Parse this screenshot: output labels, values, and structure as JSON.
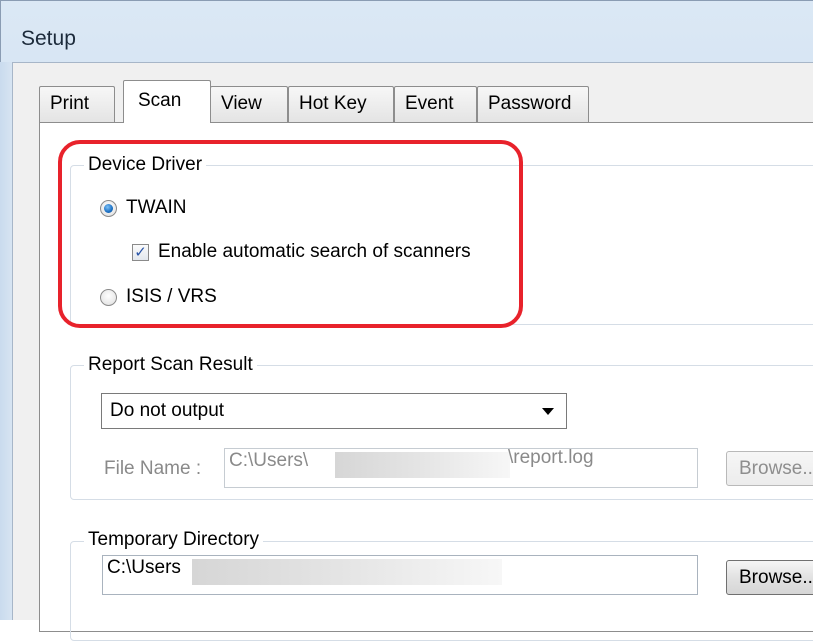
{
  "window": {
    "title": "Setup"
  },
  "tabs": [
    {
      "label": "Print"
    },
    {
      "label": "Scan"
    },
    {
      "label": "View"
    },
    {
      "label": "Hot Key"
    },
    {
      "label": "Event"
    },
    {
      "label": "Password"
    }
  ],
  "active_tab": "Scan",
  "device_driver": {
    "title": "Device Driver",
    "twain_label": "TWAIN",
    "twain_selected": true,
    "auto_search_label": "Enable automatic search of scanners",
    "auto_search_checked": true,
    "isis_label": "ISIS / VRS",
    "isis_selected": false
  },
  "report_scan_result": {
    "title": "Report Scan Result",
    "selected_option": "Do not output",
    "file_name_label": "File Name :",
    "file_name_prefix": "C:\\Users\\",
    "file_name_suffix": "\\report.log",
    "browse_label": "Browse..."
  },
  "temporary_directory": {
    "title": "Temporary Directory",
    "value_prefix": "C:\\Users",
    "browse_label": "Browse..."
  },
  "colors": {
    "highlight": "#e8222b",
    "radio_selected": "#1b6fc2"
  }
}
